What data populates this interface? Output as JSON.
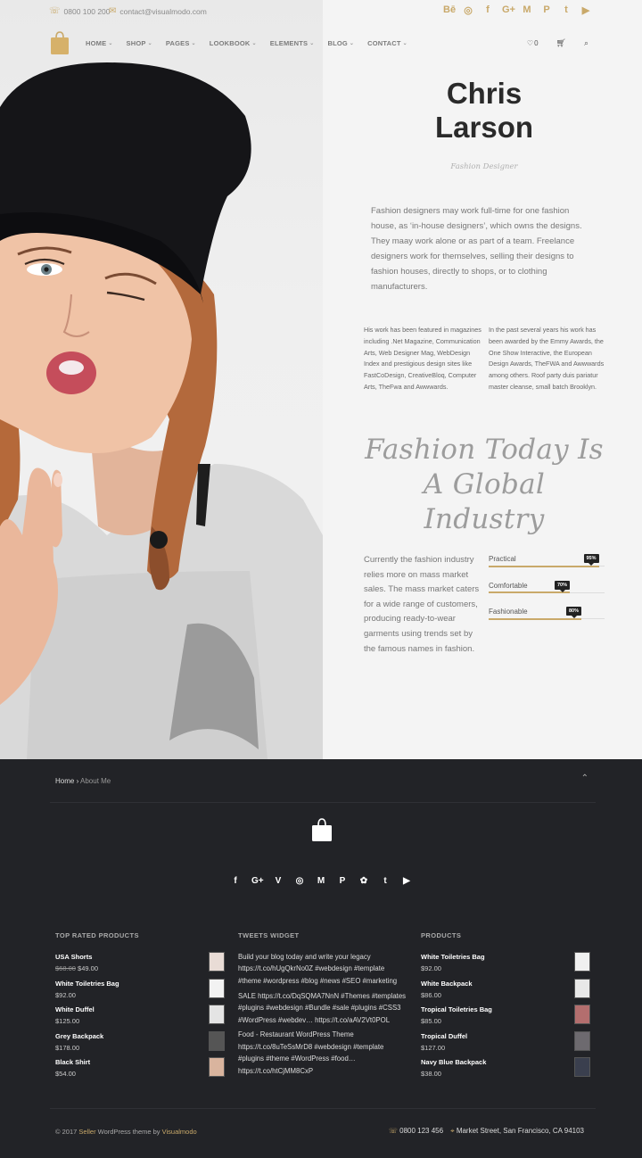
{
  "topbar": {
    "phone": "0800 100 200",
    "email": "contact@visualmodo.com",
    "social": [
      "Bē",
      "◎",
      "f",
      "G+",
      "M",
      "P",
      "t",
      "▶"
    ]
  },
  "nav": {
    "items": [
      "HOME",
      "SHOP",
      "PAGES",
      "LOOKBOOK",
      "ELEMENTS",
      "BLOG",
      "CONTACT"
    ],
    "wishlist_count": "0"
  },
  "profile": {
    "first_name": "Chris",
    "last_name": "Larson",
    "role": "Fashion Designer",
    "intro": "Fashion designers may work full-time for one fashion house, as ‘in-house designers’, which owns the designs. They maay work alone or as part of a team. Freelance designers work for themselves, selling their designs to fashion houses, directly to shops, or to clothing manufacturers.",
    "col_left": "His work has been featured in magazines including .Net Magazine, Communication Arts, Web Designer Mag, WebDesign Index and prestigious design sites like FastCoDesign, CreativeBloq, Computer Arts, TheFwa and Awwwards.",
    "col_right": "In the past several years his work has been awarded by the Emmy Awards, the One Show Interactive, the European Design Awards, TheFWA and Awwwards among others. Roof party duis pariatur master cleanse, small batch Brooklyn.",
    "quote_l1": "Fashion Today Is",
    "quote_l2": "A Global",
    "quote_l3": "Industry",
    "paragraph": "Currently the fashion industry relies more on mass market sales. The mass market caters for a wide range of customers, producing ready-to-wear garments using trends set by the famous names in fashion."
  },
  "skills": [
    {
      "label": "Practical",
      "value": 95,
      "text": "95%"
    },
    {
      "label": "Comfortable",
      "value": 70,
      "text": "70%"
    },
    {
      "label": "Fashionable",
      "value": 80,
      "text": "80%"
    }
  ],
  "footer": {
    "breadcrumb_home": "Home",
    "breadcrumb_sep": " › ",
    "breadcrumb_current": "About Me",
    "social": [
      "f",
      "G+",
      "V",
      "◎",
      "M",
      "P",
      "✿",
      "t",
      "▶"
    ],
    "top_rated_title": "TOP RATED PRODUCTS",
    "top_rated": [
      {
        "name": "USA Shorts",
        "old": "$68.00",
        "price": "$49.00"
      },
      {
        "name": "White Toiletries Bag",
        "old": "",
        "price": "$92.00"
      },
      {
        "name": "White Duffel",
        "old": "",
        "price": "$125.00"
      },
      {
        "name": "Grey Backpack",
        "old": "",
        "price": "$178.00"
      },
      {
        "name": "Black Shirt",
        "old": "",
        "price": "$54.00"
      }
    ],
    "tweets_title": "TWEETS WIDGET",
    "tweets": [
      "Build your blog today and write your legacy https://t.co/hUgQkrNo0Z #webdesign #template #theme #wordpress #blog #news #SEO #marketing",
      "SALE https://t.co/DqSQMA7NnN #Themes #templates #plugins #webdesign #Bundle #sale #plugins #CSS3 #WordPress #webdev… https://t.co/aAV2Vt0POL",
      "Food - Restaurant WordPress Theme https://t.co/8uTeSsMrD8 #webdesign #template #plugins #theme #WordPress #food… https://t.co/htCjMM8CxP"
    ],
    "products_title": "PRODUCTS",
    "products": [
      {
        "name": "White Toiletries Bag",
        "price": "$92.00"
      },
      {
        "name": "White Backpack",
        "price": "$86.00"
      },
      {
        "name": "Tropical Toiletries Bag",
        "price": "$85.00"
      },
      {
        "name": "Tropical Duffel",
        "price": "$127.00"
      },
      {
        "name": "Navy Blue Backpack",
        "price": "$38.00"
      }
    ],
    "copy_prefix": "© 2017 ",
    "copy_brand": "Seller",
    "copy_mid": " WordPress theme by ",
    "copy_author": "Visualmodo",
    "phone": "0800 123 456",
    "address": "Market Street, San Francisco, CA 94103"
  },
  "colors": {
    "accent": "#c9a96a",
    "footer_bg": "#222327"
  }
}
